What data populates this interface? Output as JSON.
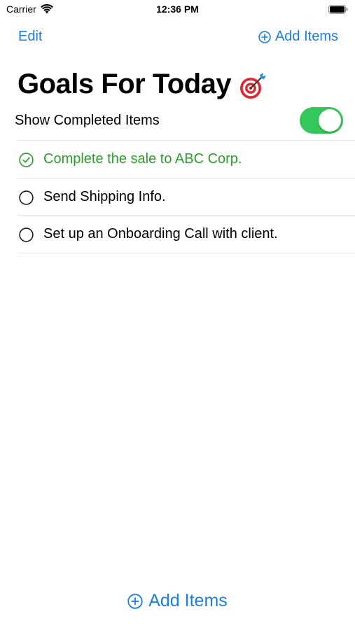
{
  "status_bar": {
    "carrier": "Carrier",
    "time": "12:36 PM",
    "icons": [
      "wifi-icon",
      "battery-icon"
    ]
  },
  "nav": {
    "edit_label": "Edit",
    "add_label": "Add Items",
    "add_icon": "plus-circle-icon"
  },
  "title": {
    "text": "Goals For Today",
    "emoji_icon": "target-icon"
  },
  "toggle": {
    "label": "Show Completed Items",
    "on": true
  },
  "items": [
    {
      "label": "Complete the sale to ABC Corp.",
      "completed": true
    },
    {
      "label": "Send Shipping Info.",
      "completed": false
    },
    {
      "label": "Set up an Onboarding Call with client.",
      "completed": false
    }
  ],
  "bottom": {
    "add_label": "Add Items",
    "add_icon": "plus-circle-icon"
  },
  "colors": {
    "accent": "#1a7fe0",
    "completed": "#2a9d2a",
    "toggle_on": "#34c759",
    "separator": "#e2e2e4"
  }
}
